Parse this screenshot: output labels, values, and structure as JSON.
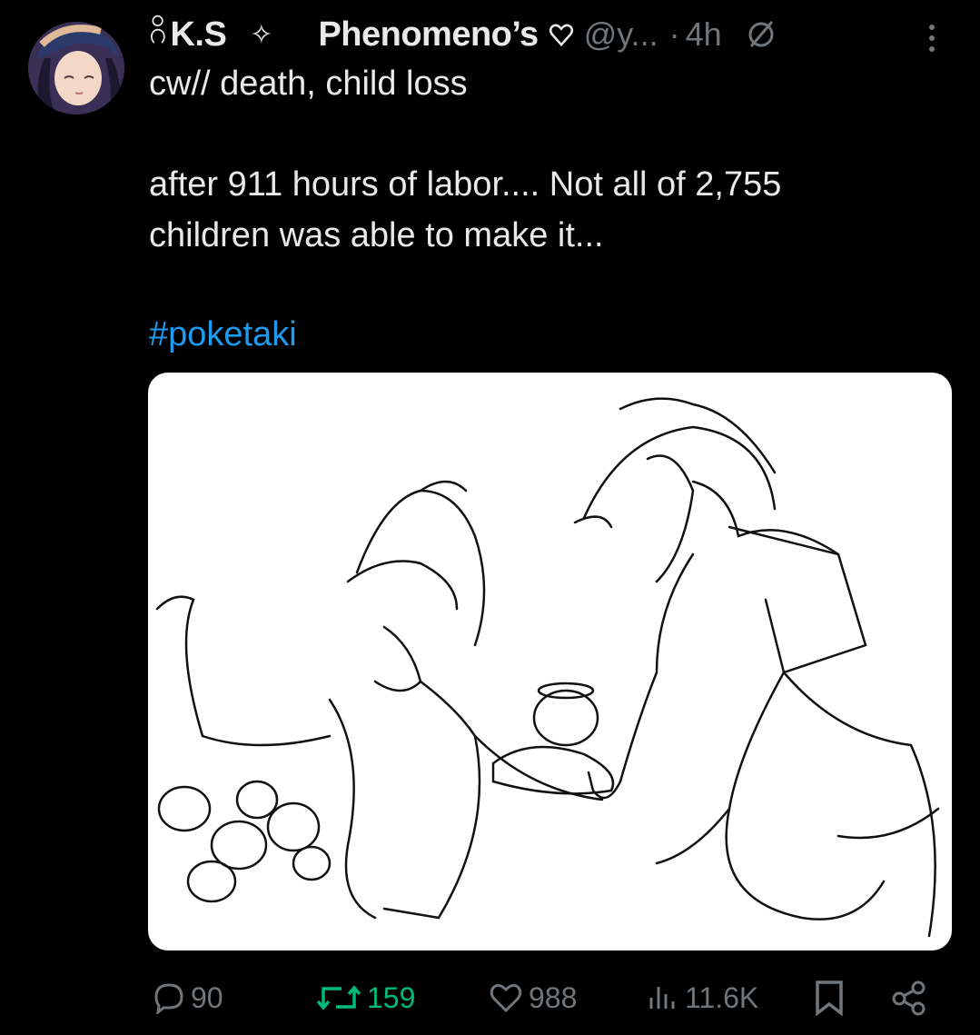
{
  "tweet": {
    "author_glyph": "ဂိ",
    "author_name": "K.S",
    "author_diamond": "✧",
    "community": "Phenomeno’s",
    "handle": "@y...",
    "separator": "·",
    "time": "4h",
    "line1": "cw// death, child loss",
    "line2": "after 911 hours of labor.... Not all of 2,755",
    "line3": "children was able to make it...",
    "hashtag": "#poketaki"
  },
  "media": {
    "description_icon": "drawing-image"
  },
  "actions": {
    "replies": "90",
    "retweets": "159",
    "likes": "988",
    "views": "11.6K"
  },
  "colors": {
    "background": "#000000",
    "text": "#e7e9ea",
    "muted": "#71767b",
    "link": "#1d9bf0",
    "retweet": "#00ba7c"
  }
}
